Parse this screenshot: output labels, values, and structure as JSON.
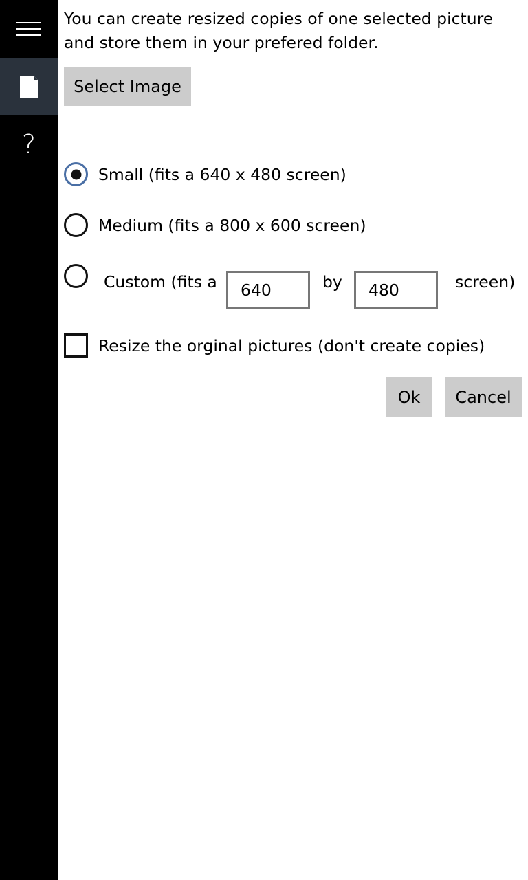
{
  "sidebar": {
    "items": [
      {
        "icon": "hamburger-menu-icon"
      },
      {
        "icon": "document-icon",
        "selected": true
      },
      {
        "icon": "help-icon",
        "glyph": "?"
      }
    ],
    "background": "#000000",
    "selected_background": "#2a323c"
  },
  "main": {
    "intro_text": "You can create resized copies of one selected picture and store them in your prefered folder.",
    "select_image_label": "Select Image",
    "size_options": [
      {
        "label": "Small (fits a 640 x 480 screen)",
        "selected": true
      },
      {
        "label": "Medium (fits a 800 x 600 screen)",
        "selected": false
      }
    ],
    "custom_option": {
      "label_prefix": "Custom (fits a",
      "width_value": "640",
      "by_label": "by",
      "height_value": "480",
      "label_suffix": "screen)",
      "selected": false
    },
    "resize_original": {
      "label": "Resize the orginal pictures (don't create copies)",
      "checked": false
    },
    "ok_label": "Ok",
    "cancel_label": "Cancel",
    "button_color": "#cccccc"
  }
}
